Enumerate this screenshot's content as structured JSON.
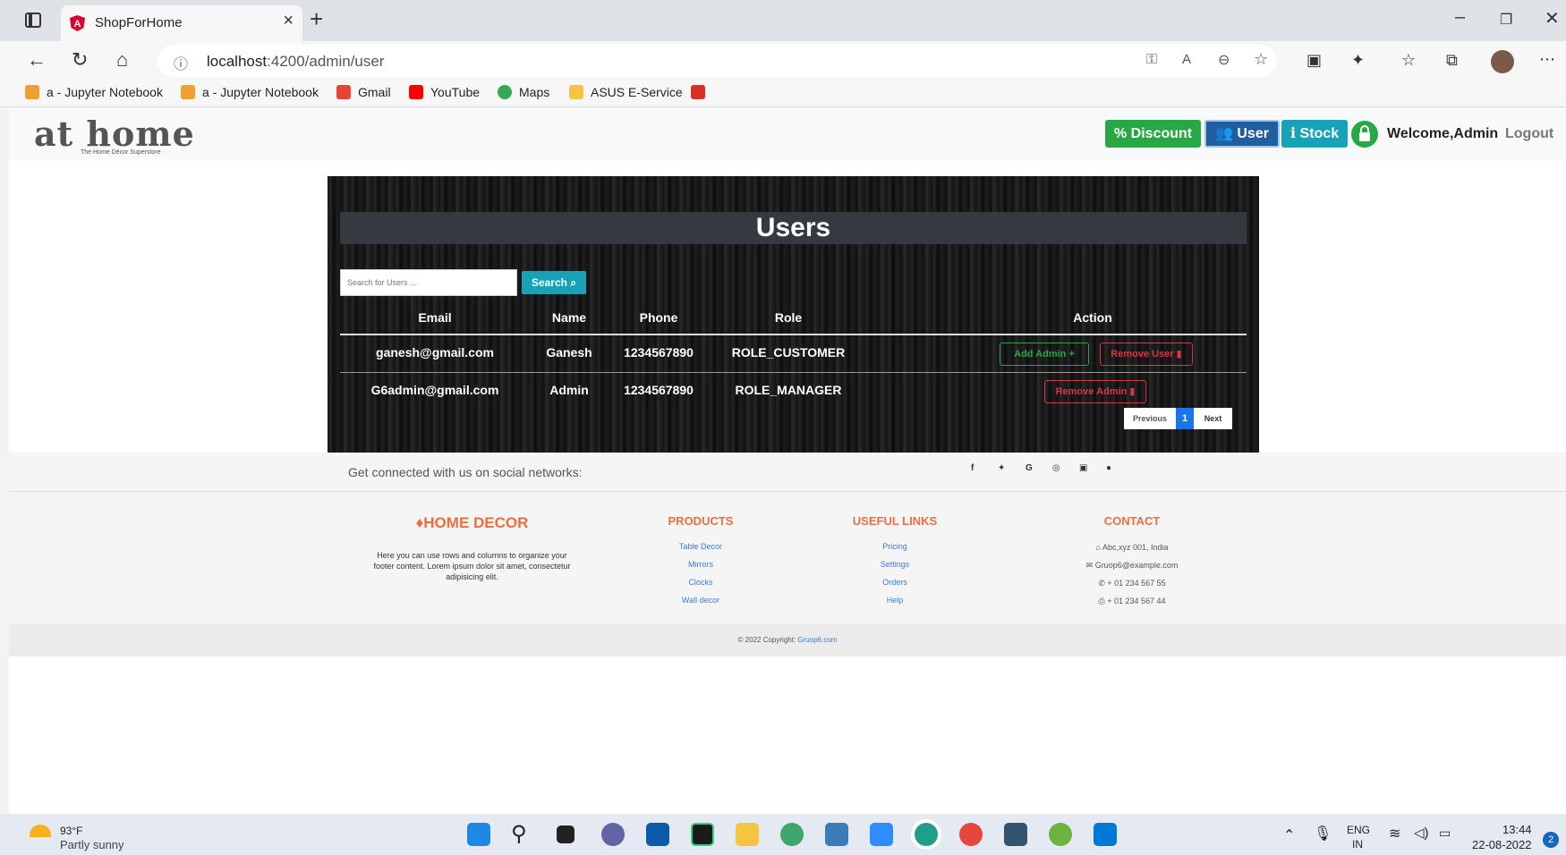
{
  "browser": {
    "tab_title": "ShopForHome",
    "url_host": "localhost",
    "url_path": ":4200/admin/user",
    "bookmarks": [
      "a - Jupyter Notebook",
      "a - Jupyter Notebook",
      "Gmail",
      "YouTube",
      "Maps",
      "ASUS E-Service"
    ]
  },
  "header": {
    "logo_main": "at home",
    "logo_sub": "The Home Décor Superstore",
    "discount_label": "Discount",
    "user_label": "User",
    "stock_label": "Stock",
    "welcome": "Welcome,Admin",
    "logout": "Logout"
  },
  "users": {
    "title": "Users",
    "search_placeholder": "Search for Users ...",
    "search_label": "Search",
    "columns": [
      "Email",
      "Name",
      "Phone",
      "Role",
      "Action"
    ],
    "rows": [
      {
        "email": "ganesh@gmail.com",
        "name": "Ganesh",
        "phone": "1234567890",
        "role": "ROLE_CUSTOMER",
        "actions": [
          "Add Admin",
          "Remove User"
        ]
      },
      {
        "email": "G6admin@gmail.com",
        "name": "Admin",
        "phone": "1234567890",
        "role": "ROLE_MANAGER",
        "actions": [
          "Remove Admin"
        ]
      }
    ],
    "pager": {
      "previous": "Previous",
      "page": "1",
      "next": "Next"
    }
  },
  "footer": {
    "social_text": "Get connected with us on social networks:",
    "social_icons": [
      "f",
      "t",
      "G",
      "◎",
      "in",
      "gh"
    ],
    "brand": "HOME DECOR",
    "brand_text_1": "Here you can use rows and columns to organize your",
    "brand_text_2": "footer content. Lorem ipsum dolor sit amet, consectetur",
    "brand_text_3": "adipisicing elit.",
    "products_head": "PRODUCTS",
    "products": [
      "Table Decor",
      "Mirrors",
      "Clocks",
      "Wall decor"
    ],
    "links_head": "USEFUL LINKS",
    "links": [
      "Pricing",
      "Settings",
      "Orders",
      "Help"
    ],
    "contact_head": "CONTACT",
    "contact": [
      "Abc,xyz 001, India",
      "Gruop6@example.com",
      "+ 01 234 567 55",
      "+ 01 234 567 44"
    ],
    "copyright": "© 2022 Copyright:",
    "copyright_link": "Gruop6.com"
  },
  "taskbar": {
    "temp": "93°F",
    "weather": "Partly sunny",
    "lang1": "ENG",
    "lang2": "IN",
    "time": "13:44",
    "date": "22-08-2022",
    "notifications": "2"
  },
  "colors": {
    "discount": "#28a745",
    "user": "#1f5fa0",
    "stock": "#17a2b8",
    "accent_orange": "#e9703e"
  }
}
